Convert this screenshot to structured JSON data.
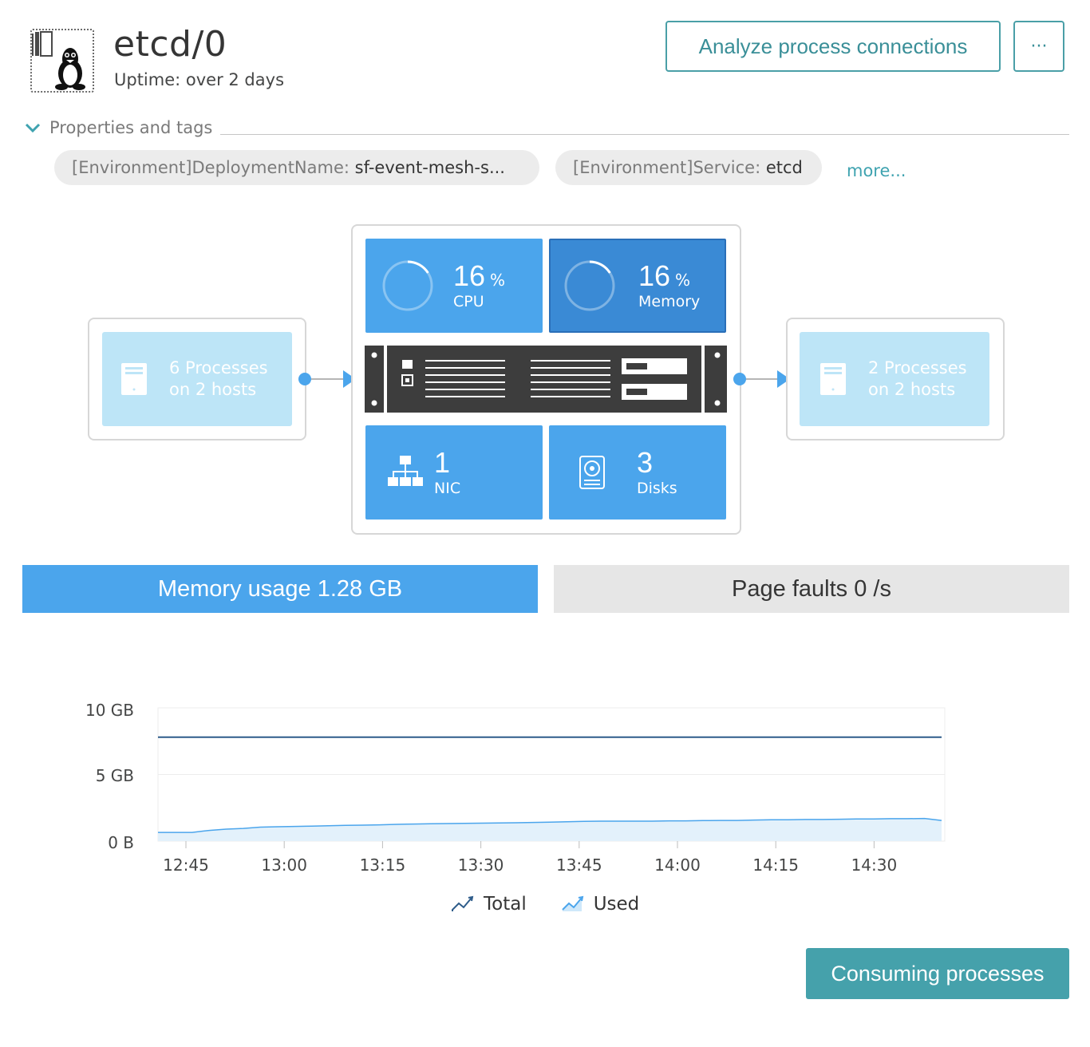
{
  "header": {
    "title": "etcd/0",
    "uptime": "Uptime: over 2 days",
    "analyze_button": "Analyze process connections",
    "more_button": "···"
  },
  "properties": {
    "label": "Properties and tags",
    "tags": [
      {
        "key": "[Environment]DeploymentName:",
        "value": "sf-event-mesh-s..."
      },
      {
        "key": "[Environment]Service:",
        "value": "etcd"
      }
    ],
    "more_link": "more..."
  },
  "infographic": {
    "incoming": {
      "line1": "6 Processes",
      "line2": "on 2 hosts"
    },
    "outgoing": {
      "line1": "2 Processes",
      "line2": "on 2 hosts"
    },
    "cpu": {
      "value": "16",
      "unit": "%",
      "label": "CPU",
      "percent": 16
    },
    "memory": {
      "value": "16",
      "unit": "%",
      "label": "Memory",
      "percent": 16
    },
    "nic": {
      "value": "1",
      "label": "NIC"
    },
    "disks": {
      "value": "3",
      "label": "Disks"
    }
  },
  "tabs": {
    "memory": "Memory usage 1.28 GB",
    "page_faults": "Page faults 0 /s"
  },
  "chart_data": {
    "type": "area",
    "x": [
      "12:45",
      "13:00",
      "13:15",
      "13:30",
      "13:45",
      "14:00",
      "14:15",
      "14:30"
    ],
    "yticks": [
      "10 GB",
      "5 GB",
      "0 B"
    ],
    "ylim": [
      0,
      10
    ],
    "series": [
      {
        "name": "Total",
        "color": "#2e5c8a",
        "values": [
          7.8,
          7.8,
          7.8,
          7.8,
          7.8,
          7.8,
          7.8,
          7.8,
          7.8,
          7.8,
          7.8,
          7.8,
          7.8,
          7.8,
          7.8,
          7.8,
          7.8,
          7.8,
          7.8,
          7.8,
          7.8,
          7.8,
          7.8,
          7.8,
          7.8,
          7.8,
          7.8,
          7.8,
          7.8,
          7.8,
          7.8,
          7.8,
          7.8,
          7.8,
          7.8,
          7.8,
          7.8,
          7.8,
          7.8,
          7.8,
          7.8,
          7.8,
          7.8,
          7.8,
          7.8,
          7.8,
          7.8
        ]
      },
      {
        "name": "Used",
        "color": "#4ba5ec",
        "values": [
          0.65,
          0.65,
          0.65,
          0.8,
          0.9,
          0.95,
          1.05,
          1.08,
          1.1,
          1.12,
          1.15,
          1.18,
          1.2,
          1.22,
          1.26,
          1.28,
          1.3,
          1.32,
          1.33,
          1.35,
          1.36,
          1.38,
          1.4,
          1.42,
          1.45,
          1.48,
          1.5,
          1.5,
          1.5,
          1.5,
          1.52,
          1.52,
          1.54,
          1.55,
          1.55,
          1.58,
          1.6,
          1.6,
          1.62,
          1.62,
          1.64,
          1.66,
          1.66,
          1.68,
          1.68,
          1.7,
          1.55
        ]
      }
    ],
    "legend": [
      "Total",
      "Used"
    ]
  },
  "footer": {
    "consume_button": "Consuming processes"
  },
  "colors": {
    "accent": "#4ba5ec",
    "teal": "#45a1ab",
    "light_blue": "#bde5f7"
  }
}
